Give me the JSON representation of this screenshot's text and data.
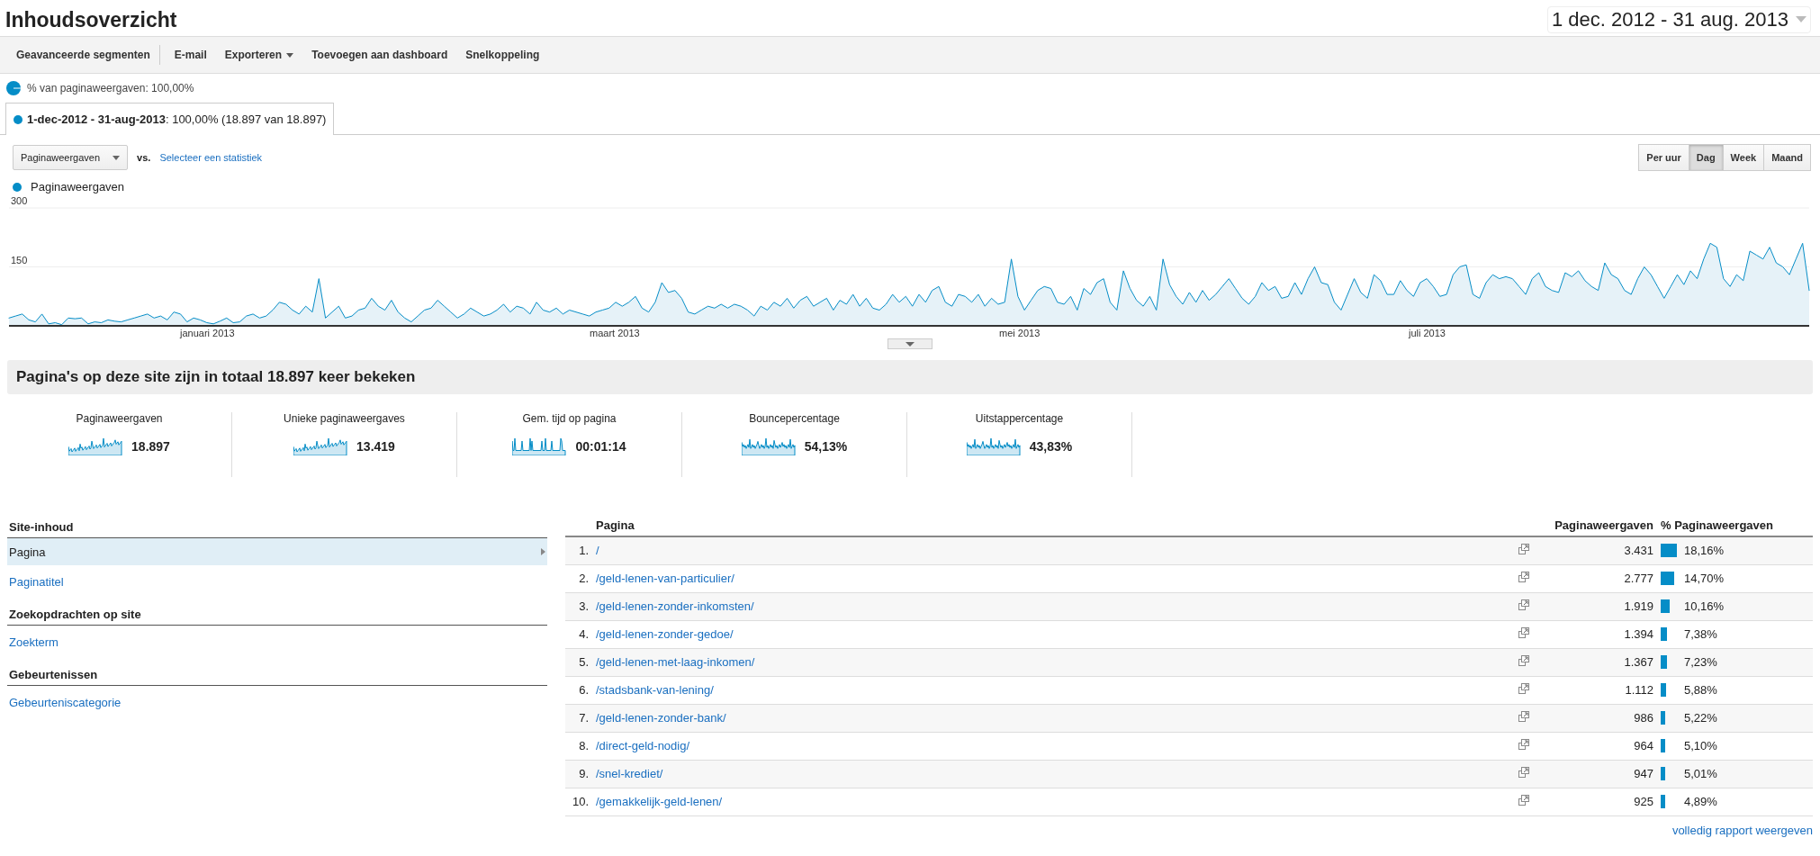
{
  "header": {
    "title": "Inhoudsoverzicht",
    "date_range": "1 dec. 2012 - 31 aug. 2013"
  },
  "toolbar": [
    {
      "label": "Geavanceerde segmenten",
      "kind": "plain"
    },
    {
      "label": "E-mail",
      "kind": "plain"
    },
    {
      "label": "Exporteren",
      "kind": "menu"
    },
    {
      "label": "Toevoegen aan dashboard",
      "kind": "plain"
    },
    {
      "label": "Snelkoppeling",
      "kind": "plain"
    }
  ],
  "segment_summary": "% van paginaweergaven: 100,00%",
  "segment": {
    "text": "**1-dec-2012 - 31-aug-2013**: 100,00% (18.897 van 18.897)"
  },
  "metric_select": {
    "value": "Paginaweergaven",
    "vs": "vs.",
    "link": "Selecteer een statistiek"
  },
  "granularity": [
    {
      "label": "Per uur",
      "selected": false
    },
    {
      "label": "Dag",
      "selected": true
    },
    {
      "label": "Week",
      "selected": false
    },
    {
      "label": "Maand",
      "selected": false
    }
  ],
  "chart": {
    "month_labels": [
      "januari 2013",
      "maart 2013",
      "mei 2013",
      "juli 2013"
    ],
    "chart_data": {
      "type": "area",
      "ylim": [
        0,
        300
      ],
      "yticks": [
        150,
        300
      ],
      "series": [
        {
          "name": "Paginaweergaven",
          "color": "#058dc7",
          "values": [
            20,
            25,
            30,
            15,
            10,
            30,
            5,
            8,
            3,
            20,
            18,
            20,
            5,
            10,
            8,
            15,
            12,
            10,
            15,
            20,
            25,
            30,
            20,
            25,
            15,
            35,
            30,
            10,
            20,
            15,
            8,
            5,
            12,
            20,
            8,
            10,
            25,
            30,
            20,
            25,
            40,
            60,
            55,
            40,
            30,
            50,
            35,
            120,
            20,
            35,
            50,
            20,
            25,
            40,
            45,
            70,
            50,
            40,
            65,
            35,
            20,
            10,
            25,
            40,
            45,
            65,
            50,
            35,
            20,
            30,
            45,
            35,
            25,
            30,
            40,
            55,
            35,
            50,
            45,
            30,
            60,
            40,
            35,
            45,
            30,
            40,
            35,
            30,
            25,
            35,
            40,
            45,
            60,
            50,
            60,
            75,
            45,
            35,
            60,
            110,
            85,
            90,
            70,
            35,
            30,
            40,
            50,
            45,
            55,
            45,
            55,
            50,
            40,
            25,
            50,
            40,
            60,
            50,
            70,
            45,
            65,
            75,
            50,
            60,
            70,
            40,
            65,
            55,
            80,
            50,
            70,
            45,
            40,
            55,
            80,
            60,
            75,
            50,
            80,
            60,
            90,
            100,
            60,
            50,
            80,
            75,
            60,
            80,
            50,
            70,
            55,
            60,
            170,
            75,
            40,
            65,
            90,
            100,
            95,
            60,
            55,
            75,
            40,
            95,
            80,
            110,
            120,
            60,
            40,
            140,
            95,
            65,
            50,
            75,
            40,
            170,
            105,
            75,
            55,
            85,
            60,
            90,
            65,
            80,
            100,
            120,
            95,
            70,
            55,
            75,
            110,
            90,
            100,
            70,
            75,
            110,
            80,
            120,
            150,
            110,
            105,
            60,
            40,
            80,
            120,
            85,
            70,
            130,
            115,
            80,
            80,
            115,
            90,
            75,
            110,
            120,
            100,
            75,
            80,
            130,
            150,
            155,
            80,
            70,
            110,
            130,
            120,
            125,
            120,
            100,
            80,
            120,
            135,
            100,
            90,
            85,
            135,
            125,
            140,
            115,
            100,
            90,
            160,
            130,
            120,
            90,
            80,
            120,
            150,
            130,
            100,
            70,
            100,
            130,
            105,
            140,
            120,
            170,
            210,
            200,
            120,
            100,
            130,
            115,
            190,
            180,
            170,
            200,
            160,
            150,
            130,
            170,
            210,
            90
          ]
        }
      ]
    }
  },
  "summary_title": "Pagina's op deze site zijn in totaal 18.897 keer bekeken",
  "metrics": [
    {
      "label": "Paginaweergaven",
      "value": "18.897"
    },
    {
      "label": "Unieke paginaweergaves",
      "value": "13.419"
    },
    {
      "label": "Gem. tijd op pagina",
      "value": "00:01:14"
    },
    {
      "label": "Bouncepercentage",
      "value": "54,13%"
    },
    {
      "label": "Uitstappercentage",
      "value": "43,83%"
    }
  ],
  "sidebar": {
    "sections": [
      {
        "title": "Site-inhoud",
        "items": [
          {
            "label": "Pagina",
            "selected": true
          },
          {
            "label": "Paginatitel",
            "selected": false
          }
        ]
      },
      {
        "title": "Zoekopdrachten op site",
        "items": [
          {
            "label": "Zoekterm",
            "selected": false
          }
        ]
      },
      {
        "title": "Gebeurtenissen",
        "items": [
          {
            "label": "Gebeurteniscategorie",
            "selected": false
          }
        ]
      }
    ]
  },
  "table": {
    "columns": [
      "Pagina",
      "Paginaweergaven",
      "% Paginaweergaven"
    ],
    "rows": [
      {
        "index": "1.",
        "page": "/",
        "views": "3.431",
        "share": "18,16%",
        "level": 0.1816
      },
      {
        "index": "2.",
        "page": "/geld-lenen-van-particulier/",
        "views": "2.777",
        "share": "14,70%",
        "level": 0.147
      },
      {
        "index": "3.",
        "page": "/geld-lenen-zonder-inkomsten/",
        "views": "1.919",
        "share": "10,16%",
        "level": 0.1016
      },
      {
        "index": "4.",
        "page": "/geld-lenen-zonder-gedoe/",
        "views": "1.394",
        "share": "7,38%",
        "level": 0.0738
      },
      {
        "index": "5.",
        "page": "/geld-lenen-met-laag-inkomen/",
        "views": "1.367",
        "share": "7,23%",
        "level": 0.0723
      },
      {
        "index": "6.",
        "page": "/stadsbank-van-lening/",
        "views": "1.112",
        "share": "5,88%",
        "level": 0.0588
      },
      {
        "index": "7.",
        "page": "/geld-lenen-zonder-bank/",
        "views": "986",
        "share": "5,22%",
        "level": 0.0522
      },
      {
        "index": "8.",
        "page": "/direct-geld-nodig/",
        "views": "964",
        "share": "5,10%",
        "level": 0.051
      },
      {
        "index": "9.",
        "page": "/snel-krediet/",
        "views": "947",
        "share": "5,01%",
        "level": 0.0501
      },
      {
        "index": "10.",
        "page": "/gemakkelijk-geld-lenen/",
        "views": "925",
        "share": "4,89%",
        "level": 0.0489
      }
    ],
    "footer_link": "volledig rapport weergeven"
  }
}
